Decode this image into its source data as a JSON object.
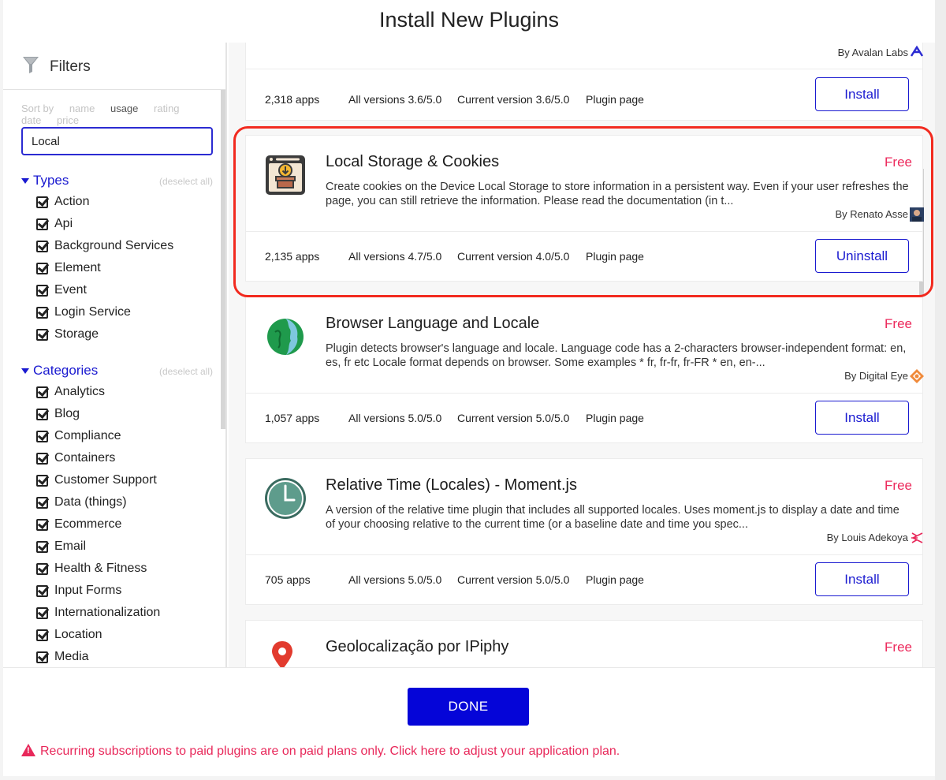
{
  "modal": {
    "title": "Install New Plugins"
  },
  "sidebar": {
    "filters_label": "Filters",
    "sort_by": {
      "label": "Sort by",
      "options": [
        "name",
        "usage",
        "rating",
        "date",
        "price"
      ],
      "active": "usage"
    },
    "search": {
      "value": "Local",
      "placeholder": ""
    },
    "types": {
      "title": "Types",
      "deselect_label": "(deselect all)",
      "items": [
        "Action",
        "Api",
        "Background Services",
        "Element",
        "Event",
        "Login Service",
        "Storage"
      ]
    },
    "categories": {
      "title": "Categories",
      "deselect_label": "(deselect all)",
      "items": [
        "Analytics",
        "Blog",
        "Compliance",
        "Containers",
        "Customer Support",
        "Data (things)",
        "Ecommerce",
        "Email",
        "Health & Fitness",
        "Input Forms",
        "Internationalization",
        "Location",
        "Media"
      ]
    }
  },
  "plugins": [
    {
      "name": "",
      "author": "By Avalan Labs",
      "apps": "2,318 apps",
      "all_versions": "All versions 3.6/5.0",
      "current_version": "Current version 3.6/5.0",
      "plugin_page": "Plugin page",
      "action": "Install"
    },
    {
      "name": "Local Storage & Cookies",
      "price": "Free",
      "description": "Create cookies on the Device Local Storage to store information in a persistent way. Even if your user refreshes the page, you can still retrieve the information. Please read the documentation (in t...",
      "author": "By Renato Asse",
      "apps": "2,135 apps",
      "all_versions": "All versions 4.7/5.0",
      "current_version": "Current version 4.0/5.0",
      "plugin_page": "Plugin page",
      "action": "Uninstall"
    },
    {
      "name": "Browser Language and Locale",
      "price": "Free",
      "description": "Plugin detects browser's language and locale. Language code has a 2-characters browser-independent format: en, es, fr etc Locale format depends on browser. Some examples * fr, fr-fr, fr-FR * en, en-...",
      "author": "By Digital Eye",
      "apps": "1,057 apps",
      "all_versions": "All versions 5.0/5.0",
      "current_version": "Current version 5.0/5.0",
      "plugin_page": "Plugin page",
      "action": "Install"
    },
    {
      "name": "Relative Time (Locales) - Moment.js",
      "price": "Free",
      "description": "A version of the relative time plugin that includes all supported locales. Uses moment.js to display a date and time of your choosing relative to the current time (or a baseline date and time you spec...",
      "author": "By Louis Adekoya",
      "apps": "705 apps",
      "all_versions": "All versions 5.0/5.0",
      "current_version": "Current version 5.0/5.0",
      "plugin_page": "Plugin page",
      "action": "Install"
    },
    {
      "name": "Geolocalização por IPiphy",
      "price": "Free"
    }
  ],
  "footer": {
    "done_label": "DONE",
    "warning": "Recurring subscriptions to paid plugins are on paid plans only. Click here to adjust your application plan."
  },
  "colors": {
    "accent": "#1a1ad0",
    "done_button": "#0505d8",
    "price": "#ec2a5c",
    "highlight": "#f22a1f"
  }
}
